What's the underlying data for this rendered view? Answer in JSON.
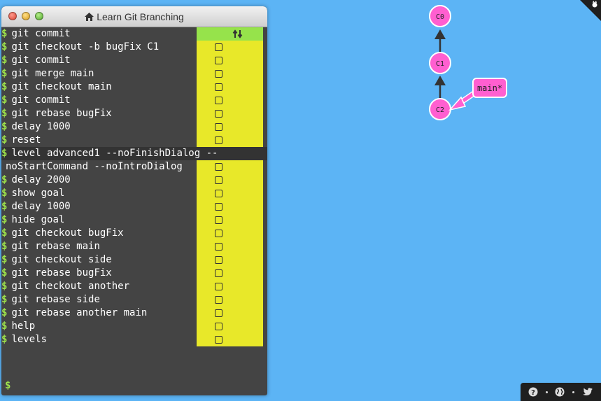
{
  "window": {
    "title": "Learn Git Branching",
    "prompt_symbol": "$"
  },
  "commands": [
    {
      "text": "git commit",
      "status": "done"
    },
    {
      "text": "git checkout -b bugFix C1",
      "status": "pending"
    },
    {
      "text": "git commit",
      "status": "pending"
    },
    {
      "text": "git merge main",
      "status": "pending"
    },
    {
      "text": "git checkout main",
      "status": "pending"
    },
    {
      "text": "git commit",
      "status": "pending"
    },
    {
      "text": "git rebase bugFix",
      "status": "pending"
    },
    {
      "text": "delay 1000",
      "status": "pending"
    },
    {
      "text": "reset",
      "status": "pending"
    },
    {
      "text": "level advanced1 --noFinishDialog --",
      "continuation": "noStartCommand --noIntroDialog",
      "status": "pending"
    },
    {
      "text": "delay 2000",
      "status": "pending"
    },
    {
      "text": "show goal",
      "status": "pending"
    },
    {
      "text": "delay 1000",
      "status": "pending"
    },
    {
      "text": "hide goal",
      "status": "pending"
    },
    {
      "text": "git checkout bugFix",
      "status": "pending"
    },
    {
      "text": "git rebase main",
      "status": "pending"
    },
    {
      "text": "git checkout side",
      "status": "pending"
    },
    {
      "text": "git rebase bugFix",
      "status": "pending"
    },
    {
      "text": "git checkout another",
      "status": "pending"
    },
    {
      "text": "git rebase side",
      "status": "pending"
    },
    {
      "text": "git rebase another main",
      "status": "pending"
    },
    {
      "text": "help",
      "status": "pending"
    },
    {
      "text": "levels",
      "status": "pending"
    }
  ],
  "graph": {
    "commits": [
      "C0",
      "C1",
      "C2"
    ],
    "branch": "main*",
    "commit_color": "#ff5fd0",
    "background": "#5cb4f5"
  },
  "footer": {
    "icons": [
      "help-icon",
      "globe-icon",
      "twitter-icon"
    ]
  }
}
